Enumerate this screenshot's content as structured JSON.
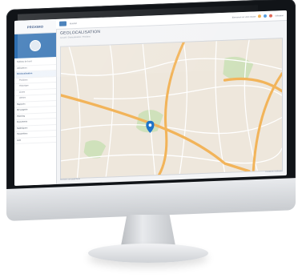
{
  "app": {
    "logo_text": "PROXIMO",
    "page_title": "GEOLOCALISATION",
    "breadcrumbs": [
      "Accueil",
      "Géolocalisation",
      "Positions"
    ],
    "topbar_label": "Mobilité",
    "topbar_right_text": "Bienvenue sur votre espace",
    "user_name": "Utilisateur"
  },
  "sidebar": {
    "items": [
      {
        "label": "Tableau de bord",
        "active": false,
        "sub": false
      },
      {
        "label": "Utilisateurs",
        "active": false,
        "sub": false
      },
      {
        "label": "Géolocalisation",
        "active": true,
        "sub": false
      },
      {
        "label": "Positions",
        "active": false,
        "sub": true
      },
      {
        "label": "Historique",
        "active": false,
        "sub": true
      },
      {
        "label": "Zones",
        "active": false,
        "sub": true
      },
      {
        "label": "Alertes",
        "active": false,
        "sub": true
      },
      {
        "label": "Rapports",
        "active": false,
        "sub": false
      },
      {
        "label": "Messagerie",
        "active": false,
        "sub": false
      },
      {
        "label": "Planning",
        "active": false,
        "sub": false
      },
      {
        "label": "Documents",
        "active": false,
        "sub": false
      },
      {
        "label": "Statistiques",
        "active": false,
        "sub": false
      },
      {
        "label": "Paramètres",
        "active": false,
        "sub": false
      },
      {
        "label": "Aide",
        "active": false,
        "sub": false
      }
    ]
  },
  "map": {
    "marker_icon": "map-pin-icon",
    "footer_left": "Données cartographiques",
    "footer_right": "Conditions d'utilisation"
  },
  "colors": {
    "accent": "#2f6fb1",
    "road_major": "#f2b45a",
    "road_minor": "#ffffff",
    "park": "#cfe1bb",
    "marker": "#1e73c8"
  }
}
